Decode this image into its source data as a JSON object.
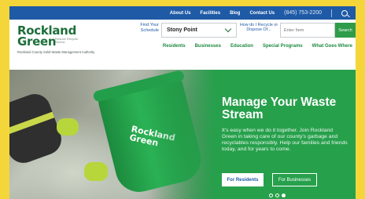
{
  "topbar": {
    "links": [
      "About Us",
      "Facilities",
      "Blog",
      "Contact Us"
    ],
    "phone": "(845) 753-2200"
  },
  "logo": {
    "line1": "Rockland",
    "line2": "Green",
    "tagline": "Reduce Recycle Renew",
    "authority": "Rockland County Solid Waste Management Authority"
  },
  "header": {
    "find_label": "Find Your Schedule",
    "schedule_value": "Stony Point",
    "recycle_label": "How do I Recycle or Dispose Of...",
    "search_placeholder": "Enter Item",
    "search_button": "Search"
  },
  "mainnav": [
    "Residents",
    "Businesses",
    "Education",
    "Special Programs",
    "What Goes Where"
  ],
  "hero": {
    "title": "Manage Your Waste Stream",
    "body": "It's easy when we do it together. Join Rockland Green in taking care of our county's garbage and recyclables responsibly. Help our families and friends today, and for years to come.",
    "btn_residents": "For Residents",
    "btn_businesses": "For Businesses",
    "bin_logo": "Rockland Green",
    "slides": 3,
    "active_slide": 3
  },
  "colors": {
    "topbar": "#1f5aa6",
    "brand_green": "#1d6e3a",
    "hero_green": "#27a04c",
    "page_bg": "#f5d63a"
  }
}
